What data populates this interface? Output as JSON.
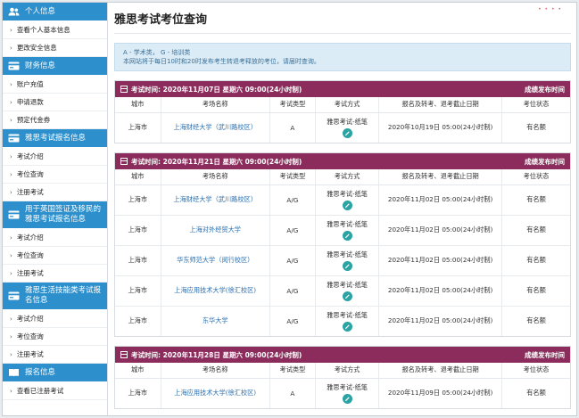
{
  "sidebar": {
    "sections": [
      {
        "title": "个人信息",
        "icon": "users-icon",
        "items": [
          "查看个人基本信息",
          "更改安全信息"
        ]
      },
      {
        "title": "财务信息",
        "icon": "credit-card-icon",
        "items": [
          "账户充值",
          "申请退款",
          "预定代金券"
        ]
      },
      {
        "title": "雅思考试报名信息",
        "icon": "credit-card-icon",
        "items": [
          "考试介绍",
          "考位查询",
          "注册考试"
        ]
      },
      {
        "title": "用于英国签证及移民的雅思考试报名信息",
        "icon": "credit-card-icon",
        "items": [
          "考试介绍",
          "考位查询",
          "注册考试"
        ]
      },
      {
        "title": "雅思生活技能类考试报名信息",
        "icon": "credit-card-icon",
        "items": [
          "考试介绍",
          "考位查询",
          "注册考试"
        ]
      },
      {
        "title": "报名信息",
        "icon": "book-icon",
        "items": [
          "查看已注册考试"
        ]
      }
    ]
  },
  "main": {
    "title": "雅思考试考位查询",
    "notice": {
      "line1": "A - 学术类， G - 培训类",
      "line2": "本网站将于每日10时和20时发布考生转退考释放的考位，请届时查询。"
    },
    "columns": [
      "城市",
      "考场名称",
      "考试类型",
      "考试方式",
      "报名及转考、退考截止日期",
      "考位状态"
    ],
    "exams": [
      {
        "date_label": "考试时间: 2020年11月07日 星期六 09:00(24小时制)",
        "release_label": "成绩发布时间",
        "rows": [
          {
            "city": "上海市",
            "venue": "上海财经大学（武川路校区）",
            "type": "A",
            "method": "雅思考试-纸笔",
            "deadline": "2020年10月19日 05:00(24小时制)",
            "status": "有名额"
          }
        ]
      },
      {
        "date_label": "考试时间: 2020年11月21日 星期六 09:00(24小时制)",
        "release_label": "成绩发布时间",
        "rows": [
          {
            "city": "上海市",
            "venue": "上海财经大学（武川路校区）",
            "type": "A/G",
            "method": "雅思考试-纸笔",
            "deadline": "2020年11月02日 05:00(24小时制)",
            "status": "有名额"
          },
          {
            "city": "上海市",
            "venue": "上海对外经贸大学",
            "type": "A/G",
            "method": "雅思考试-纸笔",
            "deadline": "2020年11月02日 05:00(24小时制)",
            "status": "有名额"
          },
          {
            "city": "上海市",
            "venue": "华东师范大学（闵行校区）",
            "type": "A/G",
            "method": "雅思考试-纸笔",
            "deadline": "2020年11月02日 05:00(24小时制)",
            "status": "有名额"
          },
          {
            "city": "上海市",
            "venue": "上海应用技术大学(徐汇校区)",
            "type": "A/G",
            "method": "雅思考试-纸笔",
            "deadline": "2020年11月02日 05:00(24小时制)",
            "status": "有名额"
          },
          {
            "city": "上海市",
            "venue": "东华大学",
            "type": "A/G",
            "method": "雅思考试-纸笔",
            "deadline": "2020年11月02日 05:00(24小时制)",
            "status": "有名额"
          }
        ]
      },
      {
        "date_label": "考试时间: 2020年11月28日 星期六 09:00(24小时制)",
        "release_label": "成绩发布时间",
        "rows": [
          {
            "city": "上海市",
            "venue": "上海应用技术大学(徐汇校区)",
            "type": "A",
            "method": "雅思考试-纸笔",
            "deadline": "2020年11月09日 05:00(24小时制)",
            "status": "有名额"
          }
        ]
      }
    ]
  },
  "colors": {
    "sidebar_header": "#2d8fcb",
    "exam_bar": "#8c2c5c",
    "notice_bg": "#dcecf7",
    "link": "#2a6fb0",
    "pen_icon": "#2aa3a3"
  }
}
